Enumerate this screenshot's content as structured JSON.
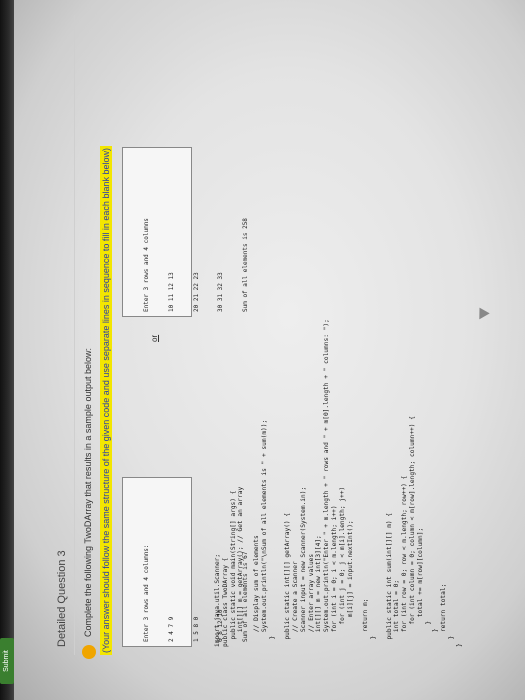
{
  "question": {
    "title": "Detailed Question 3",
    "number": "",
    "instruction": "Complete the following TwoDArray that results in a sample output below:",
    "note": "(Your answer should follow the same structure of the given code and use separate lines in sequence to fill in each blank below)",
    "or_label": "or"
  },
  "sample_output_1": [
    "Enter 3 rows and 4 columns:",
    "2 4 7 9",
    "1 5 8 0",
    "6 8 12 10",
    "Sum of all elements is 67"
  ],
  "sample_output_2": [
    "Enter 3 rows and 4 columns",
    "10 11 12 13",
    "20 21 22 23",
    "30 31 32 33",
    "Sum of all elements is 258"
  ],
  "code_lines": [
    "import java.util.Scanner;",
    "public class TwoDArray {",
    "  public static void main(String[] args) {",
    "    int[][] m = getArray(); // Get an array",
    "",
    "    // Display sum of elements",
    "    System.out.println(\"\\nSum of all elements is \" + sum(m));",
    "  }",
    "",
    "  public static int[][] getArray() {",
    "    // Create a Scanner",
    "    Scanner input = new Scanner(System.in);",
    "    // Enter array values",
    "    int[][] m = new int[3][4];",
    "    System.out.println(\"Enter \" + m.length + \" rows and \" + m[0].length + \" columns: \");",
    "    for (int i = 0; i < m.length; i++)",
    "      for (int j = 0; j < m[i].length; j++)",
    "        m[i][j] = input.nextInt();",
    "",
    "    return m;",
    "  }",
    "",
    "  public static int sum(int[][] m) {",
    "    int total = 0;",
    "    for (int row = 0; row < m.length; row++) {",
    "      for (int column = 0; column < m[row].length; column++) {",
    "        total += m[row][column];",
    "      }",
    "    }",
    "    return total;",
    "  }",
    "}"
  ],
  "submit_label": "Submit",
  "colors": {
    "highlight": "#f2e200",
    "badge": "#f0a500",
    "submit": "#3a7f2f"
  }
}
